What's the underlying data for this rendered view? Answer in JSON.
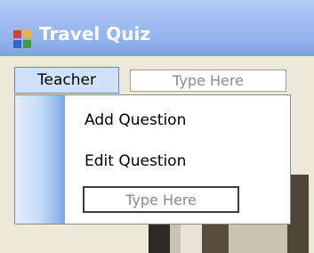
{
  "window": {
    "title": "Travel Quiz"
  },
  "menubar": {
    "menu": "Teacher",
    "type_here": "Type Here"
  },
  "dropdown": {
    "items": [
      "Add Question",
      "Edit Question"
    ],
    "type_here": "Type Here"
  },
  "colors": {
    "titlebar": "#93b4ec",
    "menu_highlight": "#cfe2f9",
    "gutter_gradient_end": "#7ea6e4"
  },
  "icons": {
    "app": "application-window-icon"
  }
}
